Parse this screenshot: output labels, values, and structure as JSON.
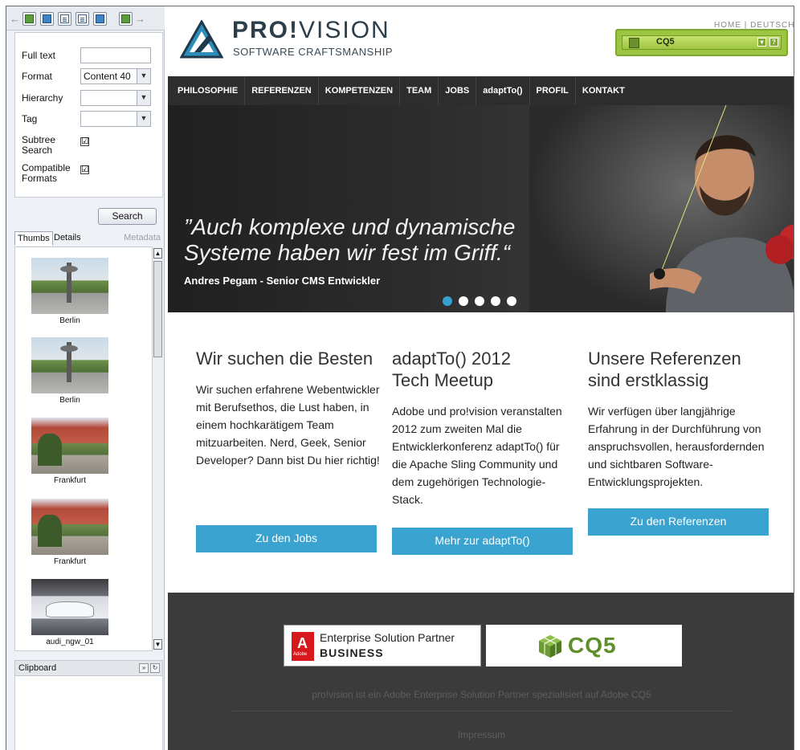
{
  "sidekick": {
    "form": {
      "fulltext_label": "Full text",
      "fulltext_value": "",
      "format_label": "Format",
      "format_value": "Content 40",
      "hierarchy_label": "Hierarchy",
      "hierarchy_value": "",
      "tag_label": "Tag",
      "tag_value": "",
      "subtree_label_1": "Subtree",
      "subtree_label_2": "Search",
      "subtree_checked": "☑",
      "compat_label_1": "Compatible",
      "compat_label_2": "Formats",
      "compat_checked": "☑",
      "search_button": "Search"
    },
    "tabs": {
      "thumbs": "Thumbs",
      "details": "Details",
      "metadata": "Metadata"
    },
    "thumbnails": [
      {
        "caption": "Berlin",
        "icon": "berlin-photo"
      },
      {
        "caption": "Berlin",
        "icon": "berlin-photo"
      },
      {
        "caption": "Frankfurt",
        "icon": "frankfurt-photo"
      },
      {
        "caption": "Frankfurt",
        "icon": "frankfurt-photo"
      },
      {
        "caption": "audi_ngw_01",
        "icon": "car-photo"
      }
    ],
    "clipboard_label": "Clipboard",
    "toolbar_icons": [
      "back-icon",
      "image-icon",
      "image2-icon",
      "page-icon",
      "list-icon",
      "gear-icon",
      "widget-icon"
    ]
  },
  "site": {
    "brand": {
      "name_bold": "PRO!",
      "name_rest": "VISION",
      "tagline": "SOFTWARE CRAFTSMANSHIP"
    },
    "top_links": "HOME | DEUTSCH",
    "cq5_bar": {
      "label": "CQ5",
      "menu_glyph": "▾",
      "help_glyph": "?"
    },
    "nav": [
      "PHILOSOPHIE",
      "REFERENZEN",
      "KOMPETENZEN",
      "TEAM",
      "JOBS",
      "adaptTo()",
      "PROFIL",
      "KONTAKT"
    ],
    "hero": {
      "quote_line1": "”Auch komplexe und dynamische",
      "quote_line2": "Systeme haben wir fest im Griff.“",
      "author": "Andres Pegam - Senior CMS Entwickler",
      "active_slide": 1,
      "slide_count": 5
    },
    "columns": [
      {
        "title_1": "Wir suchen die Besten",
        "title_2": "",
        "text": "Wir suchen erfahrene Webentwickler mit Berufsethos, die Lust haben, in einem hochkarätigem Team mitzuarbeiten. Nerd, Geek, Senior Developer? Dann bist Du hier richtig!",
        "button": "Zu den Jobs"
      },
      {
        "title_1": "adaptTo() 2012",
        "title_2": "Tech Meetup",
        "text": "Adobe und pro!vision veranstalten 2012 zum zweiten Mal die Entwicklerkonferenz adaptTo() für die Apache Sling Community und dem zugehörigen Technologie-Stack.",
        "button": "Mehr zur adaptTo()"
      },
      {
        "title_1": "Unsere Referenzen",
        "title_2": "sind erstklassig",
        "text": "Wir verfügen über langjährige Erfahrung in der Durchführung von anspruchsvollen, herausfordernden und sichtbaren Software-Entwicklungsprojekten.",
        "button": "Zu den Referenzen"
      }
    ],
    "footer": {
      "adobe_line1": "Enterprise Solution Partner",
      "adobe_line2": "BUSINESS",
      "cq5_badge": "CQ5",
      "text": "pro!vision ist ein Adobe Enterprise Solution Partner spezialisiert auf Adobe CQ5",
      "impressum": "Impressum"
    },
    "colors": {
      "accent": "#3aa3cf",
      "nav_bg": "#2d2d2d",
      "footer_bg": "#3b3b3b",
      "cq5_green": "#9cc541"
    }
  }
}
